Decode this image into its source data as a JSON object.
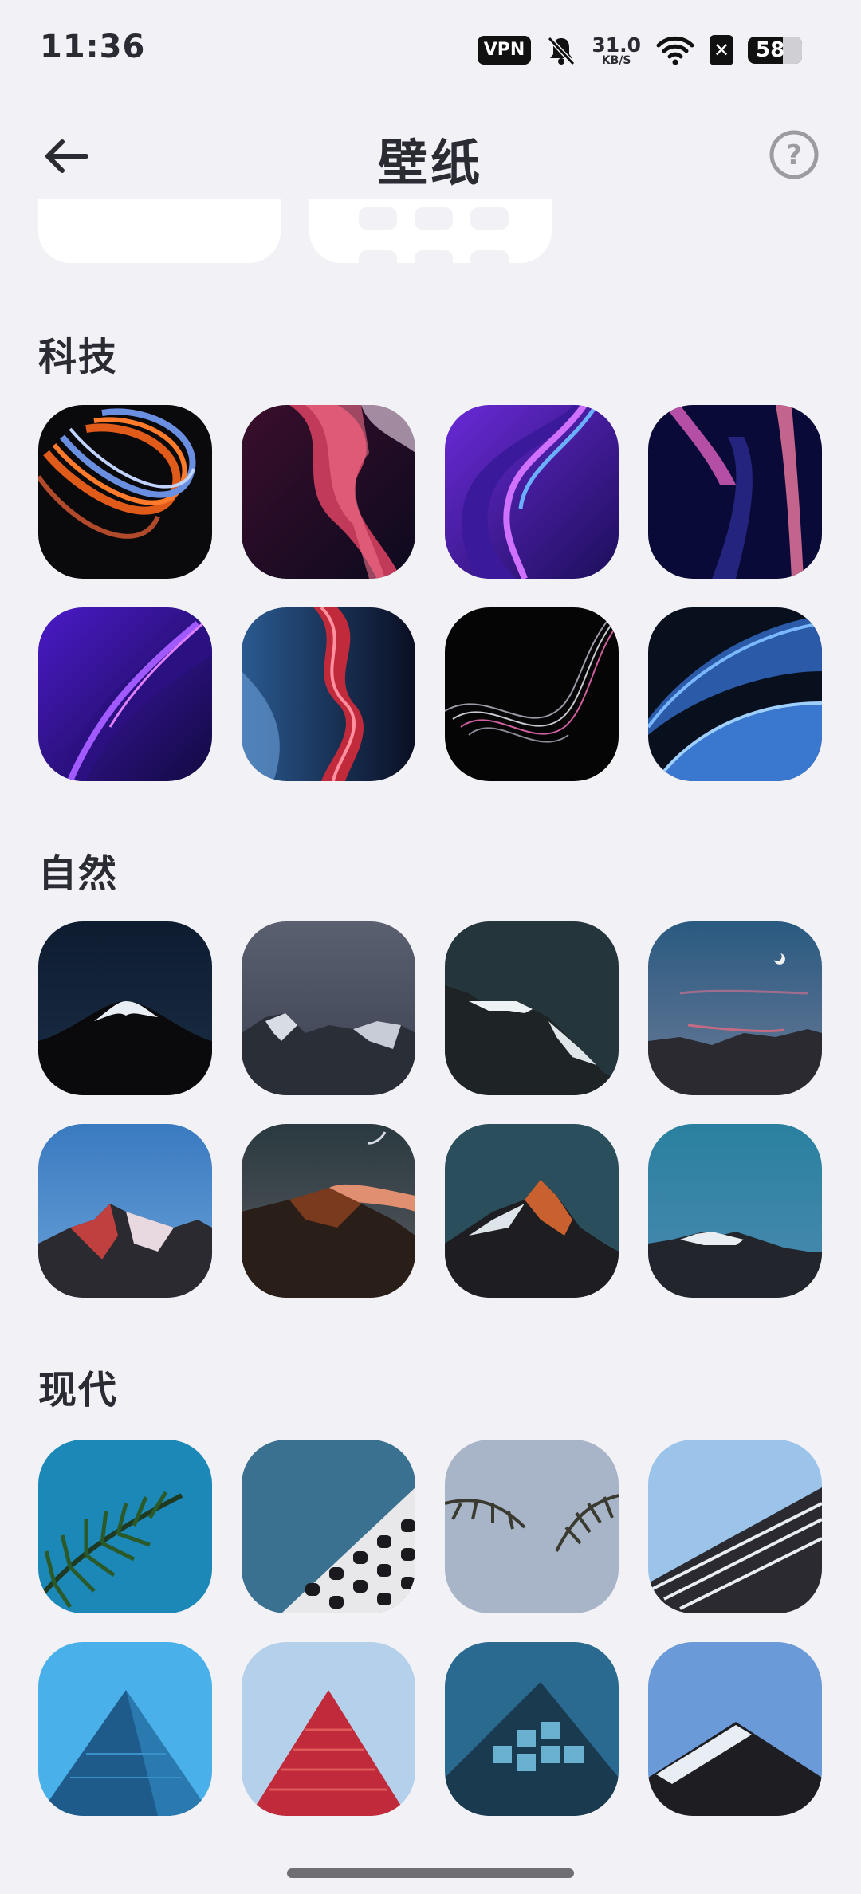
{
  "status_bar": {
    "time": "11:36",
    "vpn": "VPN",
    "speed_value": "31.0",
    "speed_unit": "KB/S",
    "battery_level": "58"
  },
  "header": {
    "title": "壁纸"
  },
  "sections": [
    {
      "title": "科技"
    },
    {
      "title": "自然"
    },
    {
      "title": "现代"
    }
  ]
}
